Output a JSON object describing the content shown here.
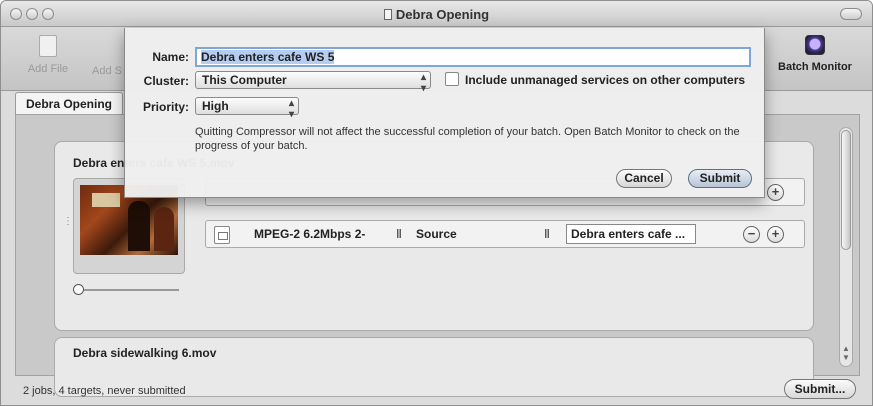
{
  "window": {
    "title": "Debra Opening"
  },
  "toolbar": {
    "add_file_label": "Add File",
    "add_surround_label": "Add S",
    "batch_monitor_label": "Batch Monitor"
  },
  "tab": {
    "label": "Debra Opening"
  },
  "jobs": [
    {
      "title": "Debra enters cafe WS 5.mov",
      "target": {
        "preset": "MPEG-2 6.2Mbps 2-",
        "destination": "Source",
        "output_name": "Debra enters cafe ..."
      }
    },
    {
      "title": "Debra sidewalking 6.mov"
    }
  ],
  "sheet": {
    "name_label": "Name:",
    "name_value": "Debra enters cafe WS 5",
    "cluster_label": "Cluster:",
    "cluster_value": "This Computer",
    "include_label": "Include unmanaged services on other computers",
    "include_checked": false,
    "priority_label": "Priority:",
    "priority_value": "High",
    "message": "Quitting Compressor will not affect the successful completion of your batch. Open Batch Monitor to check on the progress of your batch.",
    "cancel_label": "Cancel",
    "submit_label": "Submit"
  },
  "status": {
    "text": "2 jobs, 4 targets, never submitted",
    "submit_label": "Submit..."
  },
  "colors": {
    "name_field_focus": "#7fa6db",
    "default_button": "#b7c4d6"
  },
  "icons": {
    "add_file": "document-plus-icon",
    "batch_monitor": "batch-monitor-icon",
    "target": "document-icon"
  }
}
